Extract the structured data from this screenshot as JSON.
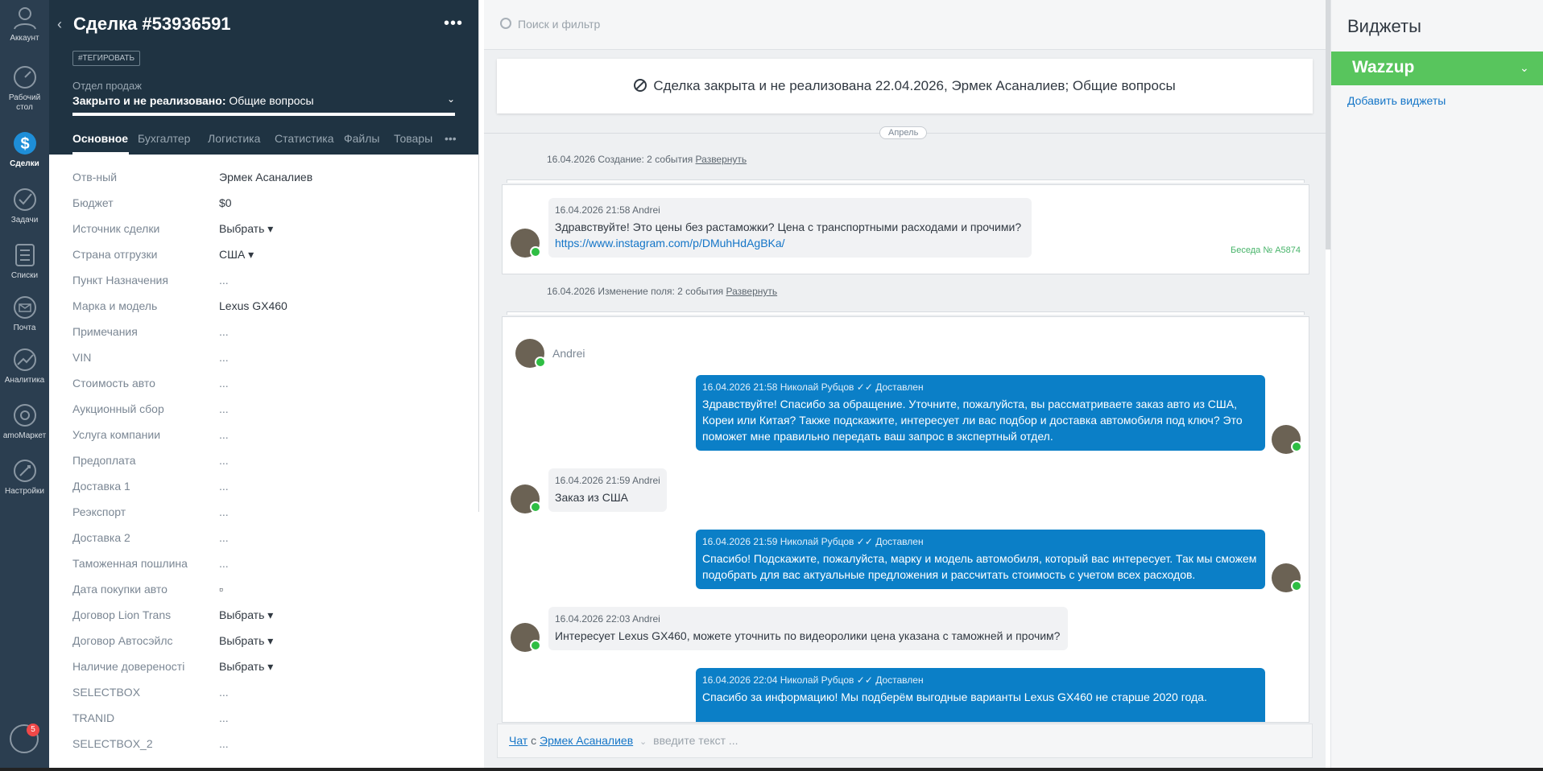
{
  "nav": {
    "items": [
      {
        "label": "Аккаунт",
        "icon": "account-icon"
      },
      {
        "label": "Рабочий стол",
        "icon": "dashboard-icon"
      },
      {
        "label": "Сделки",
        "icon": "deals-icon"
      },
      {
        "label": "Задачи",
        "icon": "tasks-icon"
      },
      {
        "label": "Списки",
        "icon": "lists-icon"
      },
      {
        "label": "Почта",
        "icon": "mail-icon"
      },
      {
        "label": "Аналитика",
        "icon": "analytics-icon"
      },
      {
        "label": "amoМаркет",
        "icon": "market-icon"
      },
      {
        "label": "Настройки",
        "icon": "settings-icon"
      }
    ],
    "notifications_count": "5"
  },
  "card": {
    "title": "Сделка #53936591",
    "more": "•••",
    "tag_button": "#ТЕГИРОВАТЬ",
    "pipeline_label": "Отдел продаж",
    "status_bold": "Закрыто и не реализовано:",
    "status_rest": " Общие вопросы",
    "tabs": [
      "Основное",
      "Бухгалтер",
      "Логистика",
      "Статистика",
      "Файлы",
      "Товары",
      "•••"
    ],
    "fields": [
      {
        "label": "Отв-ный",
        "value": "Эрмек Асаналиев"
      },
      {
        "label": "Бюджет",
        "value": "$0"
      },
      {
        "label": "Источник сделки",
        "value": "Выбрать ▾"
      },
      {
        "label": "Страна отгрузки",
        "value": "США ▾"
      },
      {
        "label": "Пункт Назначения",
        "value": "..."
      },
      {
        "label": "Марка и модель",
        "value": "Lexus GX460"
      },
      {
        "label": "Примечания",
        "value": "..."
      },
      {
        "label": "VIN",
        "value": "..."
      },
      {
        "label": "Стоимость авто",
        "value": "..."
      },
      {
        "label": "Аукционный сбор",
        "value": "..."
      },
      {
        "label": "Услуга компании",
        "value": "..."
      },
      {
        "label": "Предоплата",
        "value": "..."
      },
      {
        "label": "Доставка 1",
        "value": "..."
      },
      {
        "label": "Реэкспорт",
        "value": "..."
      },
      {
        "label": "Доставка 2",
        "value": "..."
      },
      {
        "label": "Таможенная пошлина",
        "value": "..."
      },
      {
        "label": "Дата покупки авто",
        "value": "▫"
      },
      {
        "label": "Договор Lion Trans",
        "value": "Выбрать ▾"
      },
      {
        "label": "Договор Автосэйлс",
        "value": "Выбрать ▾"
      },
      {
        "label": "Наличие довереності",
        "value": "Выбрать ▾"
      },
      {
        "label": "SELECTBOX",
        "value": "..."
      },
      {
        "label": "TRANID",
        "value": "..."
      },
      {
        "label": "SELECTBOX_2",
        "value": "..."
      }
    ]
  },
  "feed": {
    "search_placeholder": "Поиск и фильтр",
    "closed_banner": "Сделка закрыта и не реализована 22.04.2026, Эрмек Асаналиев; Общие вопросы",
    "month": "Апрель",
    "event1": "16.04.2026 Создание: 2 события",
    "event2": "16.04.2026 Изменение поля: 2 события",
    "expand": "Развернуть",
    "talk1": {
      "meta": "16.04.2026 21:58 Andrei",
      "text": "Здравствуйте! Это цены без растаможки? Цена с транспортными расходами и прочими?",
      "link": "https://www.instagram.com/p/DMuhHdAgBKa/",
      "talk_no": "Беседа № А5874"
    },
    "talk2": {
      "contact": "Andrei",
      "messages": [
        {
          "dir": "out",
          "meta": "16.04.2026 21:58 Николай Рубцов ✓✓ Доставлен",
          "text": "Здравствуйте! Спасибо за обращение. Уточните, пожалуйста, вы рассматриваете заказ авто из США, Кореи или Китая? Также подскажите, интересует ли вас подбор и доставка автомобиля под ключ? Это поможет мне правильно передать ваш запрос в экспертный отдел."
        },
        {
          "dir": "in",
          "meta": "16.04.2026 21:59 Andrei",
          "text": "Заказ из США"
        },
        {
          "dir": "out",
          "meta": "16.04.2026 21:59 Николай Рубцов ✓✓ Доставлен",
          "text": "Спасибо! Подскажите, пожалуйста, марку и модель автомобиля, который вас интересует. Так мы сможем подобрать для вас актуальные предложения и рассчитать стоимость с учетом всех расходов."
        },
        {
          "dir": "in",
          "meta": "16.04.2026 22:03 Andrei",
          "text": "Интересует Lexus GX460, можете уточнить по видеоролики цена указана с таможней и прочим?"
        },
        {
          "dir": "out",
          "meta": "16.04.2026 22:04 Николай Рубцов ✓✓ Доставлен",
          "text": "Спасибо за информацию! Мы подберём выгодные варианты Lexus GX460 не старше 2020 года."
        }
      ]
    },
    "chat": {
      "chat_link": "Чат",
      "with": "с",
      "contact_link": "Эрмек Асаналиев",
      "placeholder": "введите текст ..."
    }
  },
  "widgets": {
    "title": "Виджеты",
    "wazzup": "Wazzup",
    "add": "Добавить виджеты"
  },
  "colors": {
    "nav_bg": "#2b3e50",
    "card_head": "#1f3342",
    "outgoing": "#0b7fc7",
    "wazzup": "#58c55d",
    "link": "#1475c7"
  }
}
